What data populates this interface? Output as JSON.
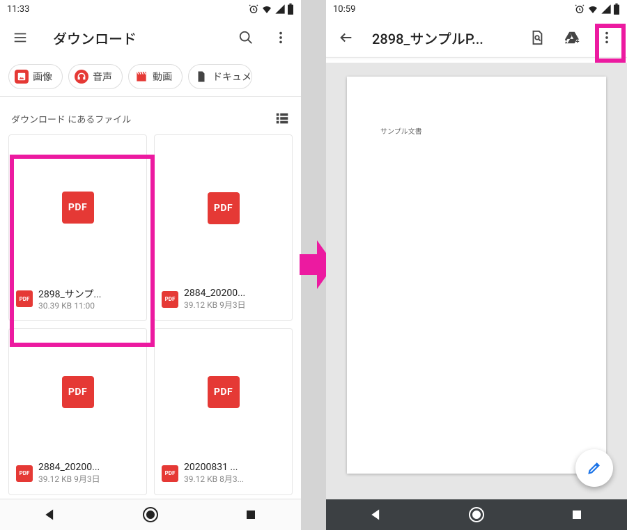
{
  "left": {
    "status": {
      "time": "11:33"
    },
    "app_bar": {
      "title": "ダウンロード"
    },
    "chips": [
      {
        "icon": "image",
        "label": "画像",
        "color": "#e53935"
      },
      {
        "icon": "audio",
        "label": "音声",
        "color": "#e53935"
      },
      {
        "icon": "video",
        "label": "動画",
        "color": "#e53935"
      },
      {
        "icon": "doc",
        "label": "ドキュメ",
        "color": "#444"
      }
    ],
    "section_label": "ダウンロード にあるファイル",
    "pdf_label": "PDF",
    "files": [
      {
        "name": "2898_サンプ...",
        "sub": "30.39 KB 11:00"
      },
      {
        "name": "2884_20200...",
        "sub": "39.12 KB 9月3日"
      },
      {
        "name": "2884_20200...",
        "sub": "39.12 KB 9月3日"
      },
      {
        "name": "20200831 ...",
        "sub": "39.12 KB 8月3..."
      }
    ]
  },
  "right": {
    "status": {
      "time": "10:59"
    },
    "app_bar": {
      "title": "2898_サンプルP..."
    },
    "doc_body": "サンプル文書"
  }
}
